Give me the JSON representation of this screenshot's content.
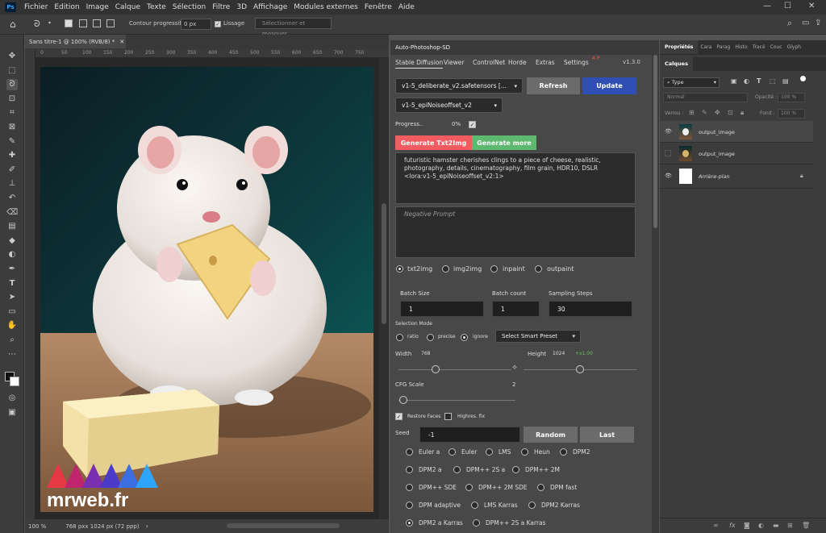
{
  "menu": {
    "app_icon": "Ps",
    "items": [
      "Fichier",
      "Edition",
      "Image",
      "Calque",
      "Texte",
      "Sélection",
      "Filtre",
      "3D",
      "Affichage",
      "Modules externes",
      "Fenêtre",
      "Aide"
    ],
    "window_controls": [
      "—",
      "☐",
      "✕"
    ]
  },
  "options_bar": {
    "contour_label": "Contour progressif :",
    "contour_value": "0 px",
    "lissage_label": "Lissage",
    "select_mask_label": "Sélectionner et masquer..."
  },
  "document": {
    "tab_title": "Sans titre-1 @ 100% (RVB/8) *",
    "ruler_ticks": [
      "0",
      "50",
      "100",
      "150",
      "200",
      "250",
      "300",
      "350",
      "400",
      "450",
      "500",
      "550",
      "600",
      "650",
      "700",
      "750"
    ],
    "zoom": "100 %",
    "doc_info": "768 pxx 1024 px (72 ppp)",
    "watermark": "mrweb.fr"
  },
  "plugin": {
    "title": "Auto-Photoshop-SD",
    "tabs": [
      "Stable Diffusion",
      "Viewer",
      "ControlNet",
      "Horde",
      "Extras",
      "Settings"
    ],
    "ap_mark": "A P",
    "version": "v1.3.0",
    "model": "v1-5_deliberate_v2.safetensors [...",
    "lora": "v1-5_epiNoiseoffset_v2",
    "refresh_label": "Refresh",
    "update_label": "Update",
    "progress_label": "Progress..",
    "progress_value": "0%",
    "generate_label": "Generate Txt2Img",
    "generate_more_label": "Generate more",
    "prompt": "futuristic hamster cherishes clings to a piece of cheese, realistic, photography, details, cinematography, film grain, HDR10, DSLR <lora:v1-5_epiNoiseoffset_v2:1>",
    "negative_placeholder": "Negative Prompt",
    "modes": [
      "txt2img",
      "img2img",
      "inpaint",
      "outpaint"
    ],
    "batch_size_label": "Batch Size",
    "batch_size": "1",
    "batch_count_label": "Batch count",
    "batch_count": "1",
    "steps_label": "Sampling Steps",
    "steps": "30",
    "selection_mode_label": "Selection Mode",
    "selection_modes": [
      "ratio",
      "precise",
      "ignore"
    ],
    "smart_preset_label": "Select Smart Preset",
    "width_label": "Width",
    "width_value": "768",
    "height_label": "Height",
    "height_value": "1024",
    "height_multiplier": "+x1.00",
    "cfg_label": "CFG Scale",
    "cfg_value": "2",
    "restore_faces_label": "Restore Faces",
    "hires_label": "Highres. fix",
    "seed_label": "Seed",
    "seed_value": "-1",
    "random_label": "Random",
    "last_label": "Last",
    "samplers": [
      [
        "Euler a",
        "Euler",
        "LMS",
        "Heun",
        "DPM2"
      ],
      [
        "DPM2 a",
        "DPM++ 2S a",
        "DPM++ 2M"
      ],
      [
        "DPM++ SDE",
        "DPM++ 2M SDE",
        "DPM fast"
      ],
      [
        "DPM adaptive",
        "LMS Karras",
        "DPM2 Karras"
      ],
      [
        "DPM2 a Karras",
        "DPM++ 2S a Karras"
      ]
    ]
  },
  "right_panel": {
    "tabs": [
      "Propriétés",
      "Cara",
      "Parag",
      "Histo",
      "Tracé",
      "Couc",
      "Glyph"
    ],
    "layers_tab": "Calques",
    "filter_type": "Type",
    "blend_mode": "Normal",
    "opacity_label": "Opacité :",
    "opacity_value": "100 %",
    "lock_label": "Verrou :",
    "fill_label": "Fond :",
    "fill_value": "100 %",
    "layers": [
      "output_image",
      "output_image",
      "Arrière-plan"
    ]
  },
  "colors": {
    "refresh_bg": "#6b6b6b",
    "update_bg": "#2f4fb5",
    "generate_bg": "#f25b5f",
    "generate_more_bg": "#5fb870",
    "height_multiplier": "#6abf69"
  }
}
